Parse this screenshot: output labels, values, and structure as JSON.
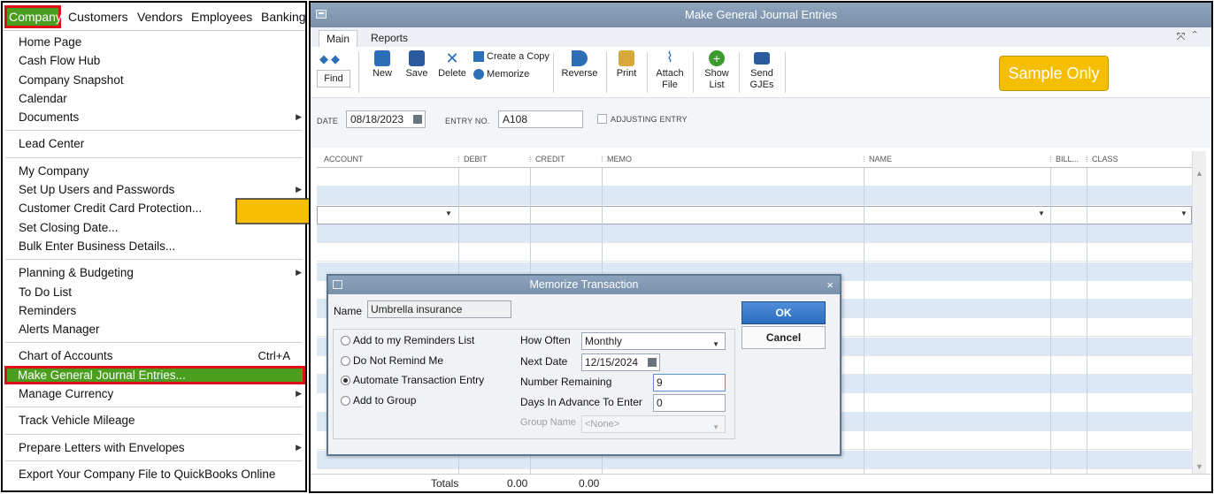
{
  "menubar": {
    "items": [
      "Company",
      "Customers",
      "Vendors",
      "Employees",
      "Banking"
    ]
  },
  "company_menu": {
    "groups": [
      [
        {
          "label": "Home Page"
        },
        {
          "label": "Cash Flow Hub"
        },
        {
          "label": "Company Snapshot"
        },
        {
          "label": "Calendar"
        },
        {
          "label": "Documents",
          "submenu": true
        }
      ],
      [
        {
          "label": "Lead Center"
        }
      ],
      [
        {
          "label": "My Company"
        },
        {
          "label": "Set Up Users and Passwords",
          "submenu": true
        },
        {
          "label": "Customer Credit Card Protection..."
        },
        {
          "label": "Set Closing Date..."
        },
        {
          "label": "Bulk Enter Business Details..."
        }
      ],
      [
        {
          "label": "Planning & Budgeting",
          "submenu": true
        },
        {
          "label": "To Do List"
        },
        {
          "label": "Reminders"
        },
        {
          "label": "Alerts Manager"
        }
      ],
      [
        {
          "label": "Chart of Accounts",
          "shortcut": "Ctrl+A"
        },
        {
          "label": "Make General Journal Entries...",
          "highlighted": true
        },
        {
          "label": "Manage Currency",
          "submenu": true
        }
      ],
      [
        {
          "label": "Track Vehicle Mileage"
        }
      ],
      [
        {
          "label": "Prepare Letters with Envelopes",
          "submenu": true
        }
      ],
      [
        {
          "label": "Export Your Company File to QuickBooks Online"
        }
      ]
    ]
  },
  "gj_window": {
    "title": "Make General Journal Entries",
    "tabs": {
      "main": "Main",
      "reports": "Reports"
    },
    "toolbar": {
      "find": "Find",
      "new": "New",
      "save": "Save",
      "delete": "Delete",
      "create_copy": "Create a Copy",
      "memorize": "Memorize",
      "reverse": "Reverse",
      "print": "Print",
      "attach_file": "Attach File",
      "show_list": "Show List",
      "send_gjes": "Send GJEs"
    },
    "sample_badge": "Sample Only",
    "form": {
      "date_label": "DATE",
      "date_value": "08/18/2023",
      "entry_no_label": "ENTRY NO.",
      "entry_no_value": "A108",
      "adjusting_label": "ADJUSTING ENTRY"
    },
    "grid": {
      "columns": [
        "ACCOUNT",
        "DEBIT",
        "CREDIT",
        "MEMO",
        "NAME",
        "BILL...",
        "CLASS"
      ]
    },
    "totals": {
      "label": "Totals",
      "debit": "0.00",
      "credit": "0.00"
    }
  },
  "memorize_dialog": {
    "title": "Memorize Transaction",
    "name_label": "Name",
    "name_value": "Umbrella insurance",
    "ok": "OK",
    "cancel": "Cancel",
    "options": [
      {
        "label": "Add to my Reminders List",
        "selected": false
      },
      {
        "label": "Do Not Remind Me",
        "selected": false
      },
      {
        "label": "Automate Transaction Entry",
        "selected": true
      },
      {
        "label": "Add to Group",
        "selected": false
      }
    ],
    "how_often_label": "How Often",
    "how_often_value": "Monthly",
    "next_date_label": "Next Date",
    "next_date_value": "12/15/2024",
    "number_remaining_label": "Number Remaining",
    "number_remaining_value": "9",
    "days_in_advance_label": "Days In Advance To Enter",
    "days_in_advance_value": "0",
    "group_name_label": "Group Name",
    "group_name_value": "<None>"
  },
  "colors": {
    "menu_highlight": "#4a9e1e",
    "callout_border": "#e0101a",
    "arrow": "#f6be00",
    "titlebar": "#7f94ae",
    "row_alt": "#dde8f6"
  }
}
